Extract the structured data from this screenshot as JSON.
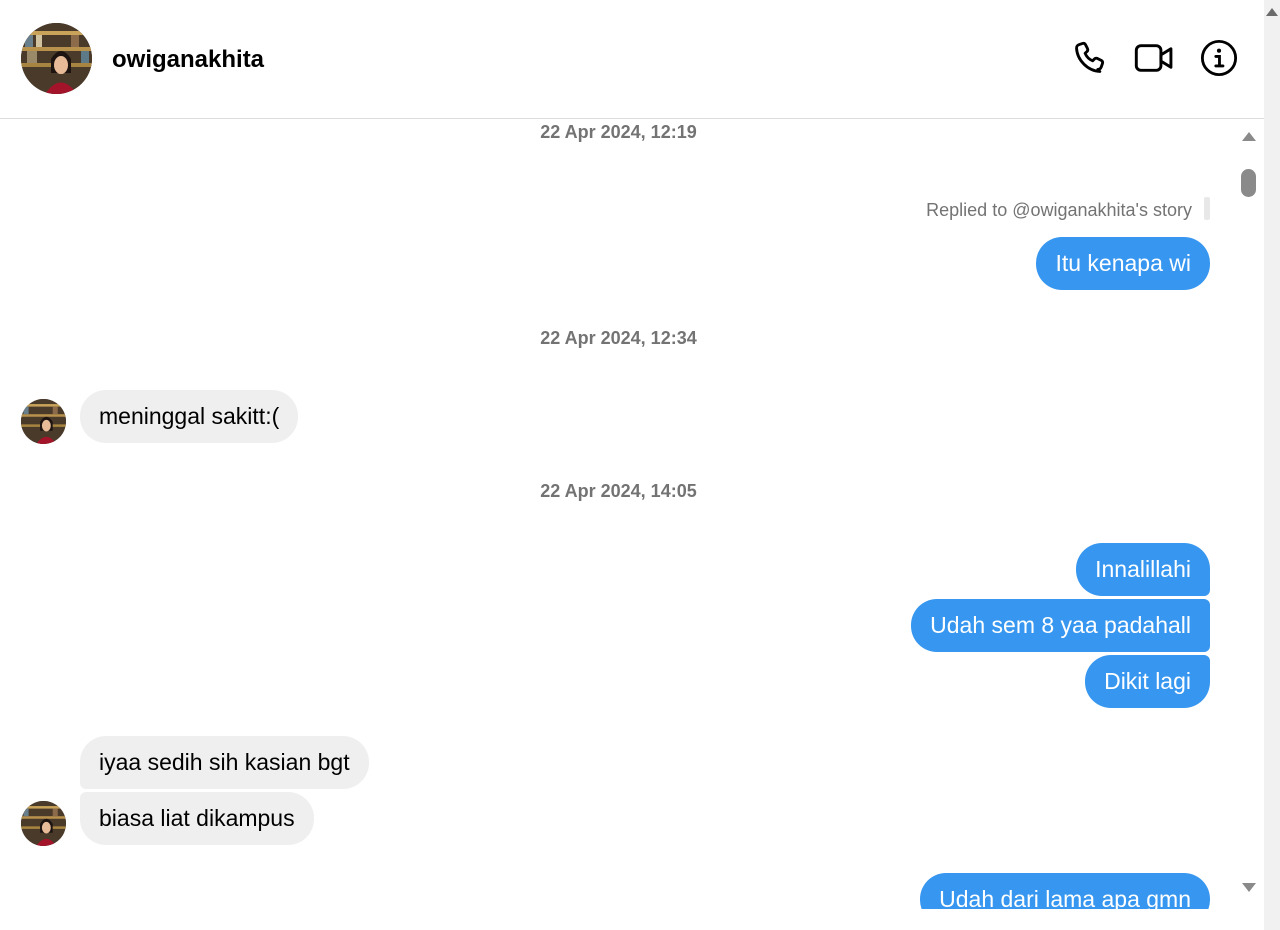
{
  "header": {
    "contact_name": "owiganakhita",
    "icons": [
      "phone-icon",
      "video-camera-icon",
      "info-icon"
    ]
  },
  "colors": {
    "outgoing_bubble": "#3797f0",
    "incoming_bubble": "#efefef",
    "timestamp_text": "#737373"
  },
  "chat": {
    "timestamps": [
      "22 Apr 2024, 12:19",
      "22 Apr 2024, 12:34",
      "22 Apr 2024, 14:05"
    ],
    "reply_note": "Replied to @owiganakhita's story",
    "messages": [
      {
        "text": "Itu kenapa wi"
      },
      {
        "text": "meninggal sakitt:("
      },
      {
        "text": "Innalillahi"
      },
      {
        "text": "Udah sem 8 yaa padahall"
      },
      {
        "text": "Dikit lagi"
      },
      {
        "text": "iyaa sedih sih kasian bgt"
      },
      {
        "text": "biasa liat dikampus"
      },
      {
        "text": "Udah dari lama apa gmn"
      }
    ]
  }
}
